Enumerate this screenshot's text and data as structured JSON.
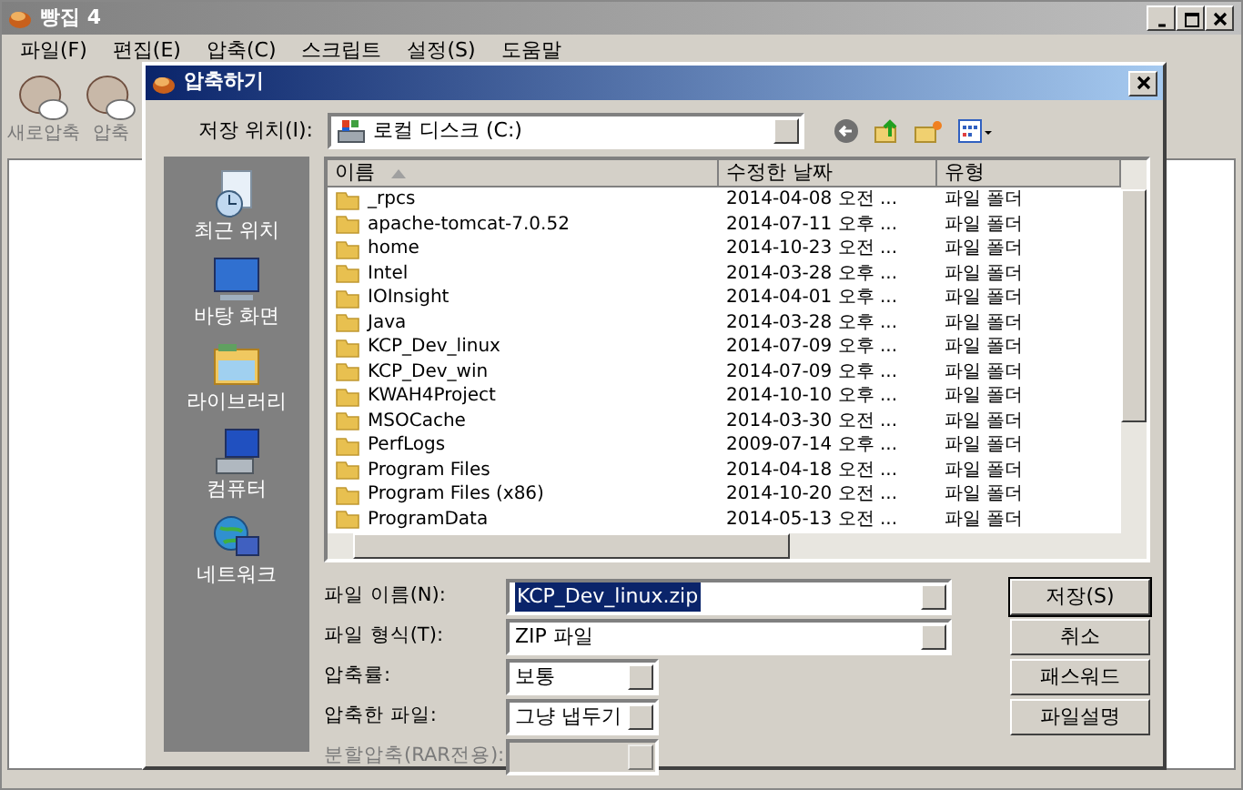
{
  "app": {
    "title": "빵집 4",
    "menu": [
      "파일(F)",
      "편집(E)",
      "압축(C)",
      "스크립트",
      "설정(S)",
      "도움말"
    ],
    "toolbar": [
      "새로압축",
      "압축"
    ]
  },
  "dialog": {
    "title": "압축하기",
    "location_label": "저장 위치(I):",
    "location": "로컬 디스크 (C:)",
    "places": [
      {
        "kind": "recent",
        "label": "최근 위치"
      },
      {
        "kind": "desktop",
        "label": "바탕 화면"
      },
      {
        "kind": "library",
        "label": "라이브러리"
      },
      {
        "kind": "computer",
        "label": "컴퓨터"
      },
      {
        "kind": "network",
        "label": "네트워크"
      }
    ],
    "columns": [
      "이름",
      "수정한 날짜",
      "유형"
    ],
    "rows": [
      {
        "name": "_rpcs",
        "modified": "2014-04-08 오전 ...",
        "type": "파일 폴더"
      },
      {
        "name": "apache-tomcat-7.0.52",
        "modified": "2014-07-11 오후 ...",
        "type": "파일 폴더"
      },
      {
        "name": "home",
        "modified": "2014-10-23 오전 ...",
        "type": "파일 폴더"
      },
      {
        "name": "Intel",
        "modified": "2014-03-28 오후 ...",
        "type": "파일 폴더"
      },
      {
        "name": "IOInsight",
        "modified": "2014-04-01 오후 ...",
        "type": "파일 폴더"
      },
      {
        "name": "Java",
        "modified": "2014-03-28 오후 ...",
        "type": "파일 폴더"
      },
      {
        "name": "KCP_Dev_linux",
        "modified": "2014-07-09 오후 ...",
        "type": "파일 폴더"
      },
      {
        "name": "KCP_Dev_win",
        "modified": "2014-07-09 오후 ...",
        "type": "파일 폴더"
      },
      {
        "name": "KWAH4Project",
        "modified": "2014-10-10 오후 ...",
        "type": "파일 폴더"
      },
      {
        "name": "MSOCache",
        "modified": "2014-03-30 오전 ...",
        "type": "파일 폴더"
      },
      {
        "name": "PerfLogs",
        "modified": "2009-07-14 오후 ...",
        "type": "파일 폴더"
      },
      {
        "name": "Program Files",
        "modified": "2014-04-18 오전 ...",
        "type": "파일 폴더"
      },
      {
        "name": "Program Files (x86)",
        "modified": "2014-10-20 오전 ...",
        "type": "파일 폴더"
      },
      {
        "name": "ProgramData",
        "modified": "2014-05-13 오전 ...",
        "type": "파일 폴더"
      }
    ],
    "fields": [
      {
        "label": "파일 이름(N):",
        "value": "KCP_Dev_linux.zip",
        "kind": "wide",
        "selected": true,
        "disabled": false
      },
      {
        "label": "파일 형식(T):",
        "value": "ZIP 파일",
        "kind": "wide",
        "selected": false,
        "disabled": false
      },
      {
        "label": "압축률:",
        "value": "보통",
        "kind": "narrow",
        "selected": false,
        "disabled": false
      },
      {
        "label": "압축한 파일:",
        "value": "그냥 냅두기",
        "kind": "narrow",
        "selected": false,
        "disabled": false
      },
      {
        "label": "분할압축(RAR전용):",
        "kind": "narrow",
        "selected": false,
        "disabled": true
      }
    ],
    "buttons": [
      {
        "label": "저장(S)",
        "default": true
      },
      {
        "label": "취소",
        "default": false
      },
      {
        "label": "패스워드",
        "default": false
      },
      {
        "label": "파일설명",
        "default": false
      }
    ]
  }
}
